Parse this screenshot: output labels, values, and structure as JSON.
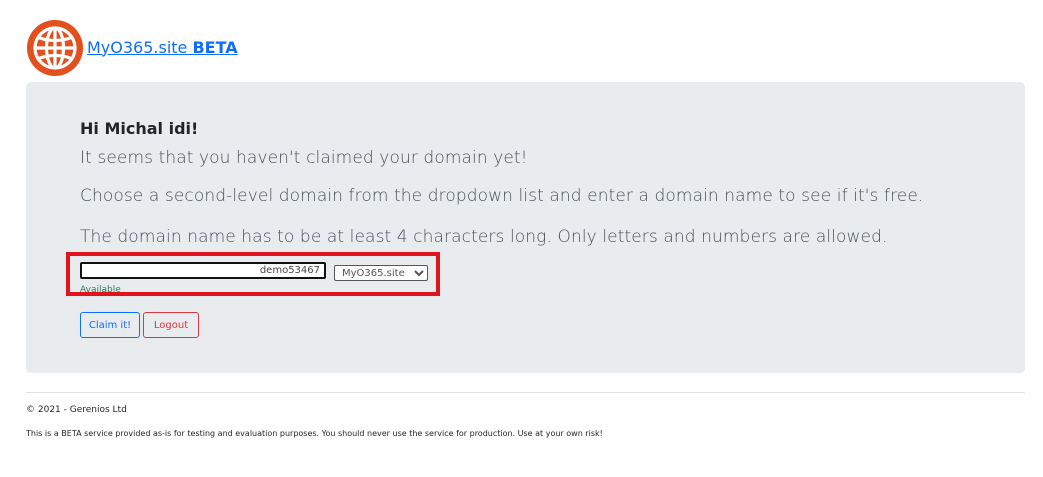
{
  "header": {
    "site_name": "MyO365.site",
    "beta": "BETA",
    "colors": {
      "logo": "#e2501e",
      "link": "#0d6efd"
    }
  },
  "main": {
    "greeting": "Hi Michal idi!",
    "line1": "It seems that you haven't claimed your domain yet!",
    "line2": "Choose a second-level domain from the dropdown list and enter a domain name to see if it's free.",
    "line3": "The domain name has to be at least 4 characters long. Only letters and numbers are allowed.",
    "domain_input": {
      "value": "demo53467"
    },
    "suffix_select": {
      "selected": "MyO365.site"
    },
    "availability": "Available",
    "claim_button": "Claim it!",
    "logout_button": "Logout",
    "highlight_color": "#e0141e"
  },
  "footer": {
    "copyright": "© 2021 - Gerenios Ltd",
    "disclaimer": "This is a BETA service provided as-is for testing and evaluation purposes. You should never use the service for production. Use at your own risk!"
  }
}
